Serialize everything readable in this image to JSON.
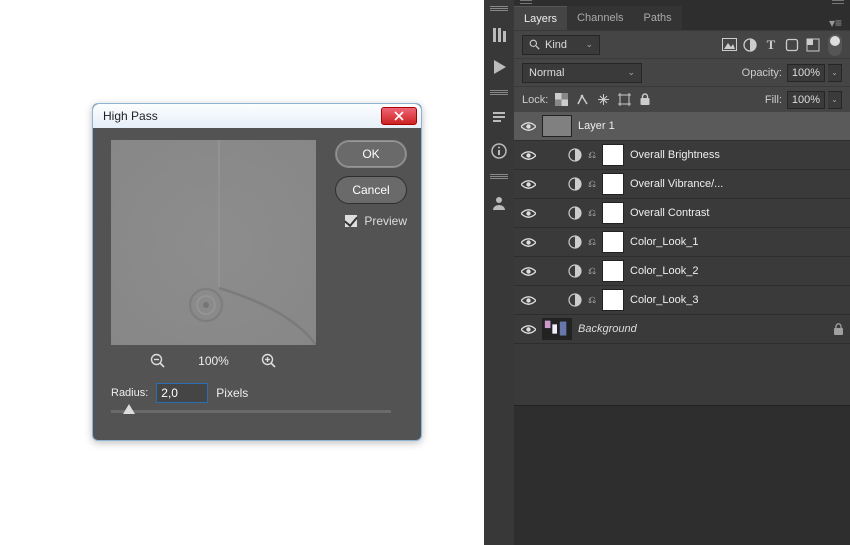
{
  "dialog": {
    "title": "High Pass",
    "ok_label": "OK",
    "cancel_label": "Cancel",
    "preview_label": "Preview",
    "preview_checked": true,
    "zoom_pct": "100%",
    "radius_label": "Radius:",
    "radius_value": "2,0",
    "radius_unit": "Pixels"
  },
  "panel": {
    "tabs": {
      "layers": "Layers",
      "channels": "Channels",
      "paths": "Paths",
      "active": "layers"
    },
    "kind": {
      "label": "Kind",
      "icon_search": "search-icon"
    },
    "blend_mode": "Normal",
    "opacity_label": "Opacity:",
    "opacity_value": "100%",
    "lock_label": "Lock:",
    "fill_label": "Fill:",
    "fill_value": "100%",
    "layers": [
      {
        "name": "Layer 1",
        "type": "pixel",
        "selected": true,
        "thumb": "grey"
      },
      {
        "name": "Overall Brightness",
        "type": "adjustment"
      },
      {
        "name": "Overall Vibrance/...",
        "type": "adjustment"
      },
      {
        "name": "Overall Contrast",
        "type": "adjustment"
      },
      {
        "name": "Color_Look_1",
        "type": "adjustment"
      },
      {
        "name": "Color_Look_2",
        "type": "adjustment"
      },
      {
        "name": "Color_Look_3",
        "type": "adjustment"
      },
      {
        "name": "Background",
        "type": "bg",
        "locked": true,
        "italic": true
      }
    ]
  }
}
